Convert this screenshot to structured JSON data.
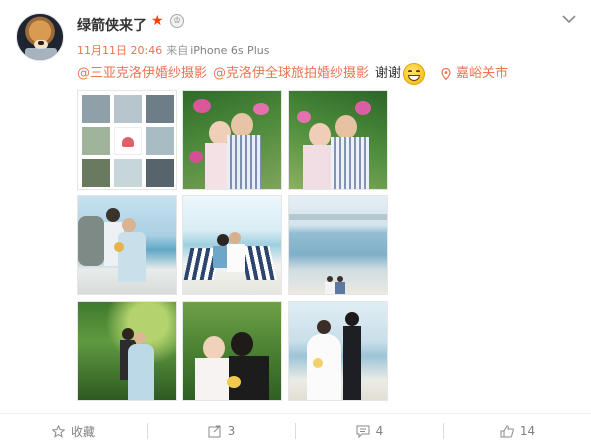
{
  "post": {
    "username": "绿箭侠来了",
    "timestamp": "11月11日 20:46",
    "source_prefix": "来自",
    "device": "iPhone 6s Plus",
    "mentions": [
      "@三亚克洛伊婚纱摄影",
      "@克洛伊全球旅拍婚纱摄影"
    ],
    "thanks": "谢谢",
    "emoji": "grin-emoji",
    "location": "嘉峪关市"
  },
  "badges": {
    "vip_icon": "star-icon",
    "level_icon": "crown-icon"
  },
  "photos": [
    {
      "id": "collage-grid",
      "subject": "wedding-photo-collage"
    },
    {
      "id": "couple-flowers-1",
      "subject": "couple-among-pink-flowers"
    },
    {
      "id": "couple-flowers-2",
      "subject": "couple-among-pink-flowers-closeup"
    },
    {
      "id": "beach-rocks",
      "subject": "couple-on-beach-rocks"
    },
    {
      "id": "beach-chairs",
      "subject": "couple-in-beach-chairs"
    },
    {
      "id": "beach-wide",
      "subject": "couple-at-seaside-wide"
    },
    {
      "id": "forest",
      "subject": "couple-in-forest"
    },
    {
      "id": "forest-kiss",
      "subject": "couple-kiss-in-greenery"
    },
    {
      "id": "beach-groom",
      "subject": "couple-on-beach-white-dress"
    }
  ],
  "actions": {
    "favorite_label": "收藏",
    "repost_count": "3",
    "comment_count": "4",
    "like_count": "14"
  },
  "colors": {
    "accent": "#eb7350",
    "text": "#333333",
    "muted": "#808080",
    "star": "#ff3d00"
  }
}
